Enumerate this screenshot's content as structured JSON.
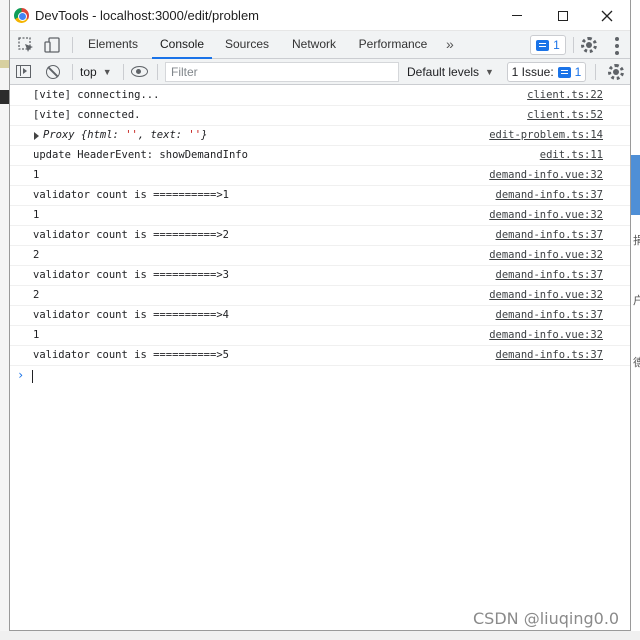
{
  "window": {
    "title": "DevTools - localhost:3000/edit/problem"
  },
  "tabs": [
    "Elements",
    "Console",
    "Sources",
    "Network",
    "Performance"
  ],
  "active_tab": "Console",
  "more_tabs_glyph": "»",
  "messages_badge": "1",
  "toolbar": {
    "context": "top",
    "filter_placeholder": "Filter",
    "levels": "Default levels",
    "issues_label": "1 Issue:",
    "issues_count": "1"
  },
  "console_rows": [
    {
      "msg": "[vite] connecting...",
      "src": "client.ts:22"
    },
    {
      "msg": "[vite] connected.",
      "src": "client.ts:52"
    },
    {
      "msg": "update HeaderEvent: showDemandInfo",
      "src": "edit.ts:11"
    },
    {
      "msg": "1",
      "src": "demand-info.vue:32"
    },
    {
      "msg": "validator count is ==========>1",
      "src": "demand-info.ts:37"
    },
    {
      "msg": "1",
      "src": "demand-info.vue:32"
    },
    {
      "msg": "validator count is ==========>2",
      "src": "demand-info.ts:37"
    },
    {
      "msg": "2",
      "src": "demand-info.vue:32"
    },
    {
      "msg": "validator count is ==========>3",
      "src": "demand-info.ts:37"
    },
    {
      "msg": "2",
      "src": "demand-info.vue:32"
    },
    {
      "msg": "validator count is ==========>4",
      "src": "demand-info.ts:37"
    },
    {
      "msg": "1",
      "src": "demand-info.vue:32"
    },
    {
      "msg": "validator count is ==========>5",
      "src": "demand-info.ts:37"
    }
  ],
  "proxy_row": {
    "prefix": "Proxy {html: ",
    "html_val": "''",
    "mid": ", text: ",
    "text_val": "''",
    "suffix": "}",
    "src": "edit-problem.ts:14"
  },
  "prompt_glyph": "›",
  "background_marks": [
    "捐",
    "户",
    "德"
  ],
  "watermark": "CSDN @liuqing0.0",
  "colors": {
    "accent": "#1a73e8",
    "string": "#c41a16"
  }
}
